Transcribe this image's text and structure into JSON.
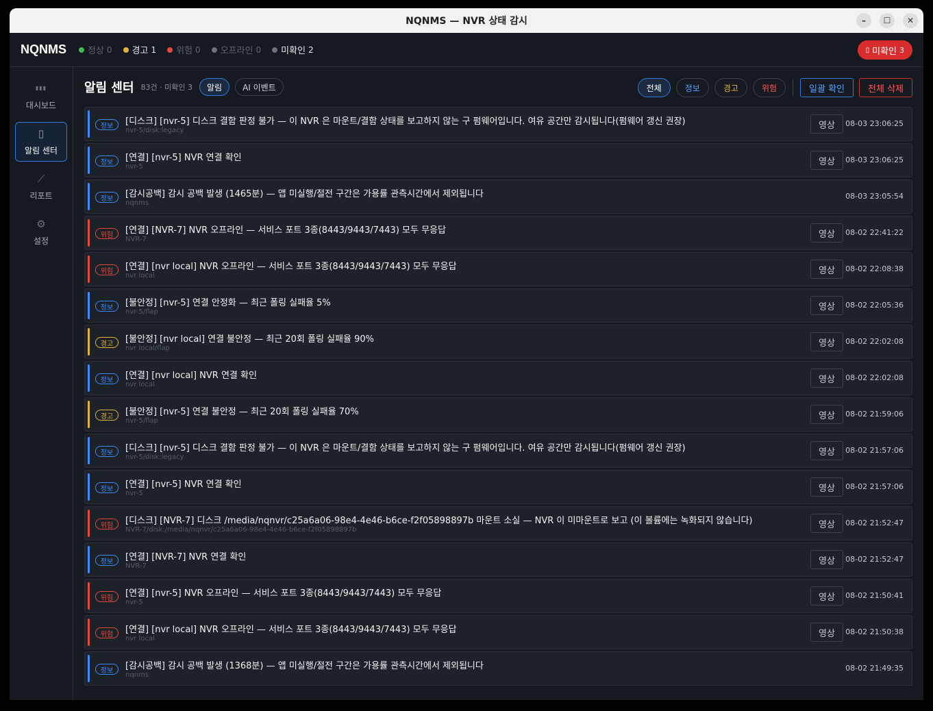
{
  "window": {
    "title": "NQNMS — NVR 상태 감시"
  },
  "topbar": {
    "brand": "NQNMS",
    "statuses": [
      {
        "label": "정상",
        "count": "0",
        "color": "#3fb950",
        "active": false
      },
      {
        "label": "경고",
        "count": "1",
        "color": "#e3b341",
        "active": true
      },
      {
        "label": "위험",
        "count": "0",
        "color": "#e5483d",
        "active": false
      },
      {
        "label": "오프라인",
        "count": "0",
        "color": "#6b7280",
        "active": false
      },
      {
        "label": "미확인",
        "count": "2",
        "color": "#6b7280",
        "active": true
      }
    ],
    "unack_label": "미확인",
    "unack_count": "3"
  },
  "sidebar": {
    "items": [
      {
        "label": "대시보드",
        "icon": "bar-chart-icon",
        "active": false
      },
      {
        "label": "알림 센터",
        "icon": "bell-icon",
        "active": true
      },
      {
        "label": "리포트",
        "icon": "line-chart-icon",
        "active": false
      },
      {
        "label": "설정",
        "icon": "gear-icon",
        "active": false
      }
    ]
  },
  "page": {
    "title": "알림 센터",
    "meta": "83건 · 미확인 3",
    "tabs": [
      "알림",
      "AI 이벤트"
    ],
    "filters": [
      {
        "label": "전체",
        "color": "#d0d4d9",
        "active": true
      },
      {
        "label": "정보",
        "color": "#5aa2ff",
        "active": false
      },
      {
        "label": "경고",
        "color": "#e3b341",
        "active": false
      },
      {
        "label": "위험",
        "color": "#ff5c5c",
        "active": false
      }
    ],
    "ack_all": "일괄 확인",
    "delete_all": "전체 삭제",
    "video_label": "영상"
  },
  "levels": {
    "info": {
      "label": "정보",
      "color": "#3d8bfd"
    },
    "warn": {
      "label": "경고",
      "color": "#e3b341"
    },
    "crit": {
      "label": "위험",
      "color": "#e5483d"
    }
  },
  "alerts": [
    {
      "level": "info",
      "message": "[디스크] [nvr-5] 디스크 결함 판정 불가 — 이 NVR 은 마운트/결함 상태를 보고하지 않는 구 펌웨어입니다. 여유 공간만 감시됩니다(펌웨어 갱신 권장)",
      "source": "nvr-5/disk:legacy",
      "time": "08-03 23:06:25",
      "video": true
    },
    {
      "level": "info",
      "message": "[연결] [nvr-5] NVR 연결 확인",
      "source": "nvr-5",
      "time": "08-03 23:06:25",
      "video": true
    },
    {
      "level": "info",
      "message": "[감시공백] 감시 공백 발생 (1465분) — 앱 미실행/절전 구간은 가용률 관측시간에서 제외됩니다",
      "source": "nqnms",
      "time": "08-03 23:05:54",
      "video": false
    },
    {
      "level": "crit",
      "message": "[연결] [NVR-7] NVR 오프라인 — 서비스 포트 3종(8443/9443/7443) 모두 무응답",
      "source": "NVR-7",
      "time": "08-02 22:41:22",
      "video": true
    },
    {
      "level": "crit",
      "message": "[연결] [nvr local] NVR 오프라인 — 서비스 포트 3종(8443/9443/7443) 모두 무응답",
      "source": "nvr local",
      "time": "08-02 22:08:38",
      "video": true
    },
    {
      "level": "info",
      "message": "[불안정] [nvr-5] 연결 안정화 — 최근 폴링 실패율 5%",
      "source": "nvr-5/flap",
      "time": "08-02 22:05:36",
      "video": true
    },
    {
      "level": "warn",
      "message": "[불안정] [nvr local] 연결 불안정 — 최근 20회 폴링 실패율 90%",
      "source": "nvr local/flap",
      "time": "08-02 22:02:08",
      "video": true
    },
    {
      "level": "info",
      "message": "[연결] [nvr local] NVR 연결 확인",
      "source": "nvr local",
      "time": "08-02 22:02:08",
      "video": true
    },
    {
      "level": "warn",
      "message": "[불안정] [nvr-5] 연결 불안정 — 최근 20회 폴링 실패율 70%",
      "source": "nvr-5/flap",
      "time": "08-02 21:59:06",
      "video": true
    },
    {
      "level": "info",
      "message": "[디스크] [nvr-5] 디스크 결함 판정 불가 — 이 NVR 은 마운트/결함 상태를 보고하지 않는 구 펌웨어입니다. 여유 공간만 감시됩니다(펌웨어 갱신 권장)",
      "source": "nvr-5/disk:legacy",
      "time": "08-02 21:57:06",
      "video": true
    },
    {
      "level": "info",
      "message": "[연결] [nvr-5] NVR 연결 확인",
      "source": "nvr-5",
      "time": "08-02 21:57:06",
      "video": true
    },
    {
      "level": "crit",
      "message": "[디스크] [NVR-7] 디스크 /media/nqnvr/c25a6a06-98e4-4e46-b6ce-f2f05898897b 마운트 소실 — NVR 이 미마운트로 보고 (이 볼륨에는 녹화되지 않습니다)",
      "source": "NVR-7/disk:/media/nqnvr/c25a6a06-98e4-4e46-b6ce-f2f05898897b",
      "time": "08-02 21:52:47",
      "video": true
    },
    {
      "level": "info",
      "message": "[연결] [NVR-7] NVR 연결 확인",
      "source": "NVR-7",
      "time": "08-02 21:52:47",
      "video": true
    },
    {
      "level": "crit",
      "message": "[연결] [nvr-5] NVR 오프라인 — 서비스 포트 3종(8443/9443/7443) 모두 무응답",
      "source": "nvr-5",
      "time": "08-02 21:50:41",
      "video": true
    },
    {
      "level": "crit",
      "message": "[연결] [nvr local] NVR 오프라인 — 서비스 포트 3종(8443/9443/7443) 모두 무응답",
      "source": "nvr local",
      "time": "08-02 21:50:38",
      "video": true
    },
    {
      "level": "info",
      "message": "[감시공백] 감시 공백 발생 (1368분) — 앱 미실행/절전 구간은 가용률 관측시간에서 제외됩니다",
      "source": "nqnms",
      "time": "08-02 21:49:35",
      "video": false
    }
  ]
}
